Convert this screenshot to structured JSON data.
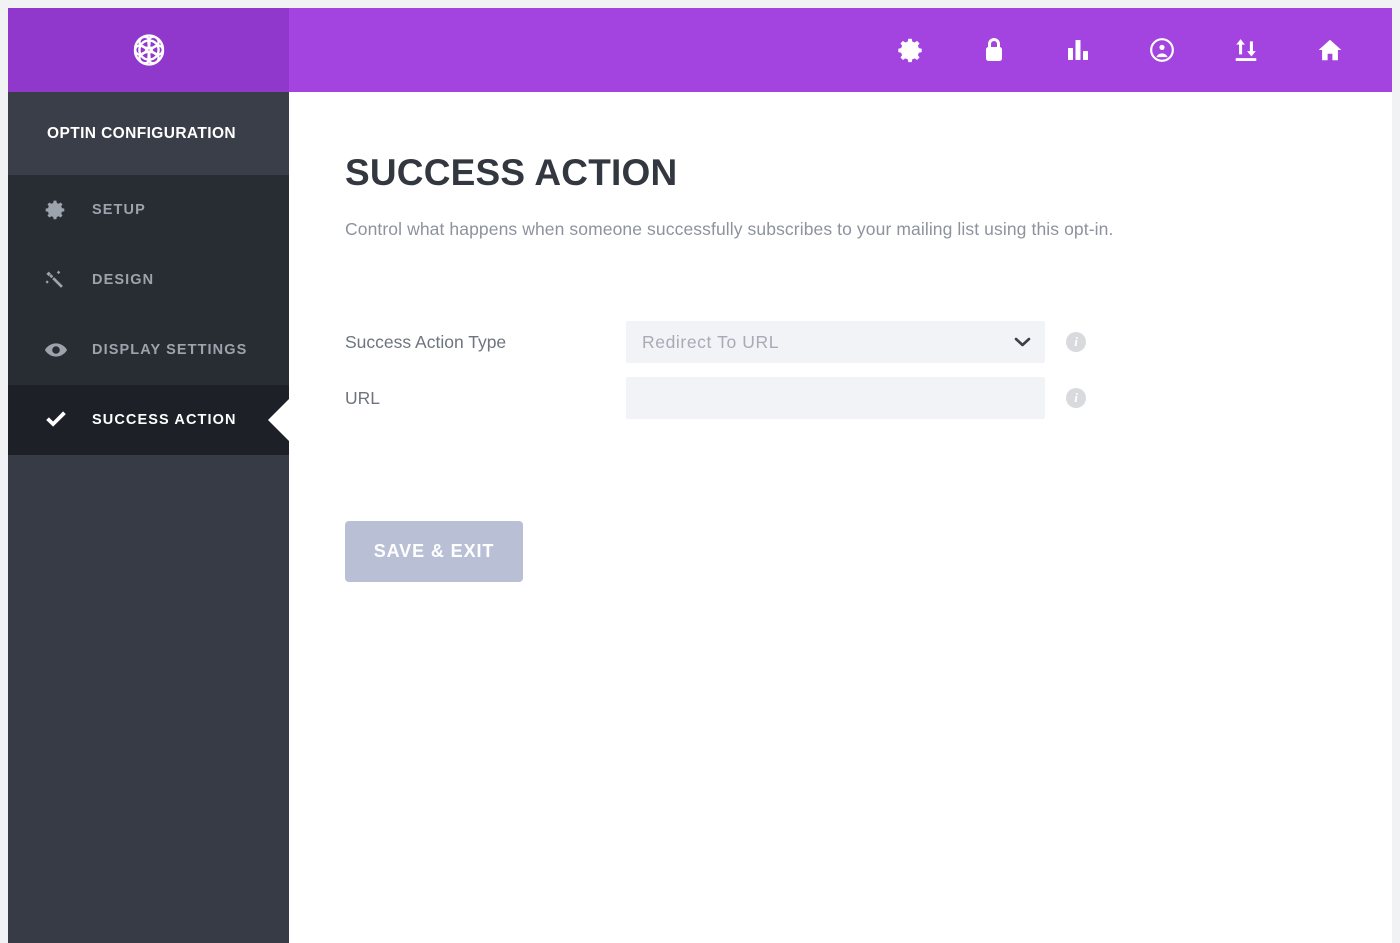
{
  "topbar": {
    "logo_name": "optin-monster-rosette-logo",
    "icons": [
      {
        "name": "gear-icon",
        "label": "Settings"
      },
      {
        "name": "lock-icon",
        "label": "Security"
      },
      {
        "name": "bar-chart-icon",
        "label": "Analytics"
      },
      {
        "name": "user-circle-icon",
        "label": "Account"
      },
      {
        "name": "import-export-icon",
        "label": "Import / Export"
      },
      {
        "name": "home-icon",
        "label": "Home"
      }
    ]
  },
  "sidebar": {
    "title": "OPTIN CONFIGURATION",
    "items": [
      {
        "label": "SETUP",
        "icon": "gear-icon",
        "active": false
      },
      {
        "label": "DESIGN",
        "icon": "magic-wand-icon",
        "active": false
      },
      {
        "label": "DISPLAY SETTINGS",
        "icon": "eye-icon",
        "active": false
      },
      {
        "label": "SUCCESS ACTION",
        "icon": "check-icon",
        "active": true
      }
    ]
  },
  "main": {
    "title": "SUCCESS ACTION",
    "description": "Control what happens when someone successfully subscribes to your mailing list using this opt-in.",
    "fields": [
      {
        "label": "Success Action Type",
        "type": "select",
        "value": "Redirect To URL",
        "info": "i"
      },
      {
        "label": "URL",
        "type": "text",
        "value": "",
        "placeholder": "",
        "info": "i"
      }
    ],
    "save_label": "SAVE & EXIT"
  },
  "colors": {
    "brand_purple": "#a343e0",
    "brand_purple_dark": "#9038cb",
    "sidebar": "#373b45",
    "sidebar_menu": "#282c33",
    "sidebar_active": "#1d2027",
    "save_button": "#b9c0d6",
    "field_bg": "#f2f3f6",
    "page_bg": "#f1f2f4"
  }
}
